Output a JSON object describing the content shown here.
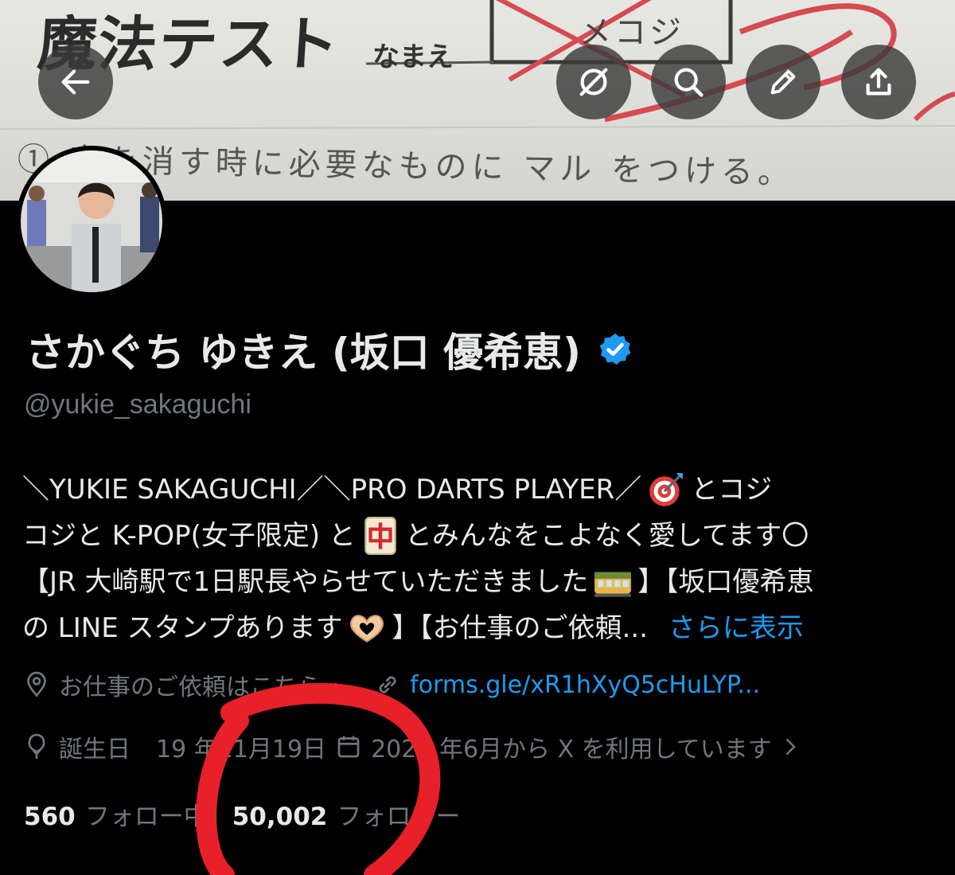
{
  "banner": {
    "title": "魔法テスト",
    "name_label": "なまえ",
    "name_written": "メコジ",
    "question": "① 字を消す時に必要なものに マル をつける。"
  },
  "toolbar": {
    "back_icon": "arrow-left-icon",
    "grok_icon": "grok-icon",
    "search_icon": "search-icon",
    "edit_icon": "pencil-icon",
    "share_icon": "share-icon"
  },
  "profile": {
    "display_name": "さかぐち ゆきえ (坂口 優希恵)",
    "handle": "@yukie_sakaguchi",
    "bio": {
      "line1_a": "＼YUKIE SAKAGUCHI／＼PRO DARTS PLAYER／",
      "line1_b": "とコジ",
      "line2_a": "コジと K-POP(女子限定) と",
      "line2_b": "とみんなをこよなく愛してます〇",
      "line3_a": "【JR 大崎駅で1日駅長やらせていただきました",
      "line3_b": "】【坂口優希恵",
      "line4_a": "の LINE スタンプあります",
      "line4_b": "】【お仕事のご依頼...",
      "show_more": "さらに表示"
    },
    "location": "お仕事のご依頼はこちら→",
    "link": "forms.gle/xR1hXyQ5cHuLYP...",
    "birthday_label": "誕生日",
    "birthday_value": "19  年11月19日",
    "joined": "2020 年6月から X を利用しています",
    "following_count": "560",
    "following_label": "フォロー中",
    "followers_count": "50,002",
    "followers_label": "フォロワー"
  },
  "colors": {
    "accent": "#1d9bf0",
    "secondary_text": "#71767b",
    "annotation": "#e8202a"
  }
}
